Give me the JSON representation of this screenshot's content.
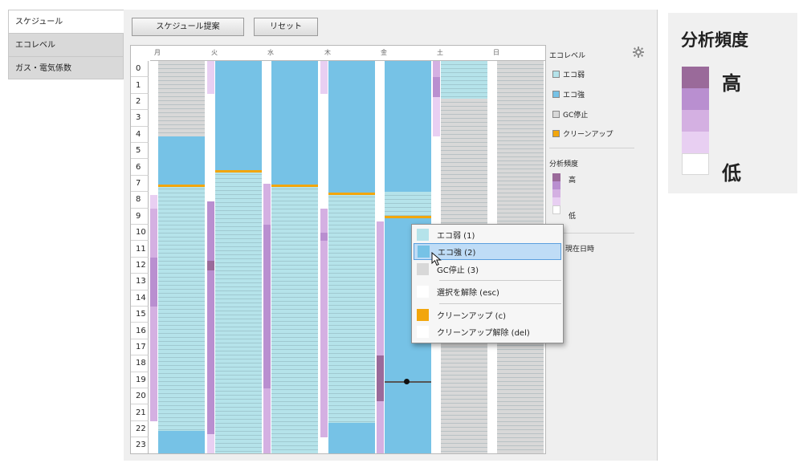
{
  "sidebar": {
    "tabs": [
      {
        "label": "スケジュール",
        "active": true
      },
      {
        "label": "エコレベル",
        "active": false
      },
      {
        "label": "ガス・電気係数",
        "active": false
      }
    ]
  },
  "toolbar": {
    "propose_label": "スケジュール提案",
    "reset_label": "リセット"
  },
  "schedule": {
    "days": [
      "月",
      "火",
      "水",
      "木",
      "金",
      "土",
      "日"
    ],
    "hours": [
      "0",
      "1",
      "2",
      "3",
      "4",
      "5",
      "6",
      "7",
      "8",
      "9",
      "10",
      "11",
      "12",
      "13",
      "14",
      "15",
      "16",
      "17",
      "18",
      "19",
      "20",
      "21",
      "22",
      "23"
    ],
    "colors": {
      "eco_weak": "#b5e3ea",
      "eco_strong": "#76c2e6",
      "gc_stop": "#d8d8d8",
      "cleanup": "#f2a60c",
      "freq_1": "#ffffff",
      "freq_2": "#e8cff2",
      "freq_3": "#d4b0e2",
      "freq_4": "#b98fd0",
      "freq_5": "#9a6a9a"
    }
  },
  "legend": {
    "title": "エコレベル",
    "items": [
      "エコ弱",
      "エコ強",
      "GC停止",
      "クリーンアップ"
    ],
    "freq_title": "分析頻度",
    "freq_high": "高",
    "freq_low": "低",
    "now_label": "現在日時",
    "gear_icon": "gear-icon"
  },
  "context_menu": {
    "items": [
      {
        "label": "エコ弱 (1)",
        "icon_color": "#b5e3ea",
        "highlighted": false
      },
      {
        "label": "エコ強 (2)",
        "icon_color": "#76c2e6",
        "highlighted": true
      },
      {
        "label": "GC停止 (3)",
        "icon_color": "#d8d8d8",
        "highlighted": false
      },
      {
        "label": "選択を解除 (esc)",
        "icon_color": "",
        "highlighted": false
      },
      {
        "label": "クリーンアップ (c)",
        "icon_color": "#f2a60c",
        "highlighted": false
      },
      {
        "label": "クリーンアップ解除 (del)",
        "icon_color": "",
        "highlighted": false
      }
    ]
  },
  "big_legend": {
    "title": "分析頻度",
    "high": "高",
    "low": "低"
  }
}
